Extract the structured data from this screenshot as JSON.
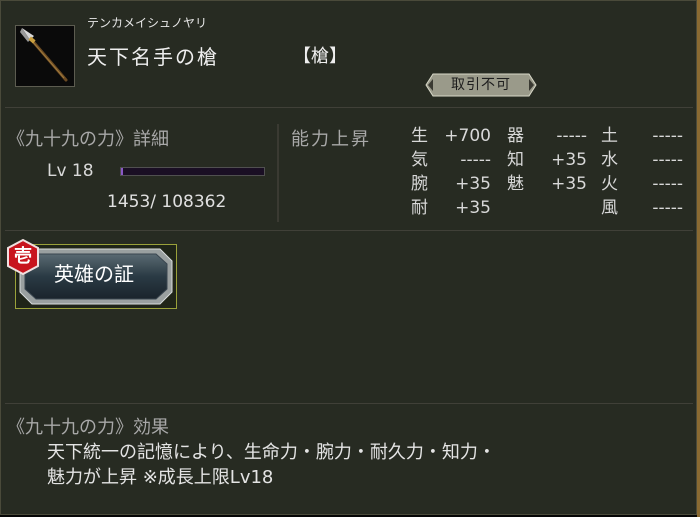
{
  "item": {
    "reading": "テンカメイシュノヤリ",
    "name": "天下名手の槍",
    "type": "【槍】",
    "trade_badge": "取引不可",
    "icon": "spear-icon"
  },
  "detail": {
    "title": "《九十九の力》詳細",
    "level": "Lv 18",
    "exp_text": "1453/  108362",
    "exp_fraction": 0.0134
  },
  "stats": {
    "header": "能力上昇",
    "col1": [
      {
        "label": "生",
        "value": "+700"
      },
      {
        "label": "気",
        "value": "-----"
      },
      {
        "label": "腕",
        "value": "+35"
      },
      {
        "label": "耐",
        "value": "+35"
      }
    ],
    "col2": [
      {
        "label": "器",
        "value": "-----"
      },
      {
        "label": "知",
        "value": "+35"
      },
      {
        "label": "魅",
        "value": "+35"
      }
    ],
    "col3": [
      {
        "label": "土",
        "value": "-----"
      },
      {
        "label": "水",
        "value": "-----"
      },
      {
        "label": "火",
        "value": "-----"
      },
      {
        "label": "風",
        "value": "-----"
      }
    ]
  },
  "hero": {
    "badge": "壱",
    "label": "英雄の証"
  },
  "effect": {
    "title": "《九十九の力》効果",
    "line1": "天下統一の記憶により、生命力・腕力・耐久力・知力・",
    "line2": "魅力が上昇 ※成長上限Lv18"
  },
  "colors": {
    "panel_bg": "#272b22",
    "trade_badge_bg": "#9a9a8a",
    "exp_bar_fill": "#8a58c8",
    "hero_border": "#9aa13a",
    "badge_red": "#c8141e"
  }
}
